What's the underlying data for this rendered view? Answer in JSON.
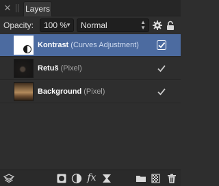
{
  "panel": {
    "tab_label": "Layers"
  },
  "controls": {
    "opacity_label": "Opacity:",
    "opacity_value": "100 %",
    "blend_mode": "Normal"
  },
  "layers": [
    {
      "name": "Kontrast",
      "kind": "(Curves Adjustment)",
      "selected": true,
      "visible": true
    },
    {
      "name": "Retuš",
      "kind": "(Pixel)",
      "selected": false,
      "visible": true
    },
    {
      "name": "Background",
      "kind": "(Pixel)",
      "selected": false,
      "visible": true
    }
  ],
  "toolbar": {
    "fx_label": "fx"
  },
  "colors": {
    "panel_bg": "#2e2e2e",
    "selection": "#4c6ba0"
  }
}
